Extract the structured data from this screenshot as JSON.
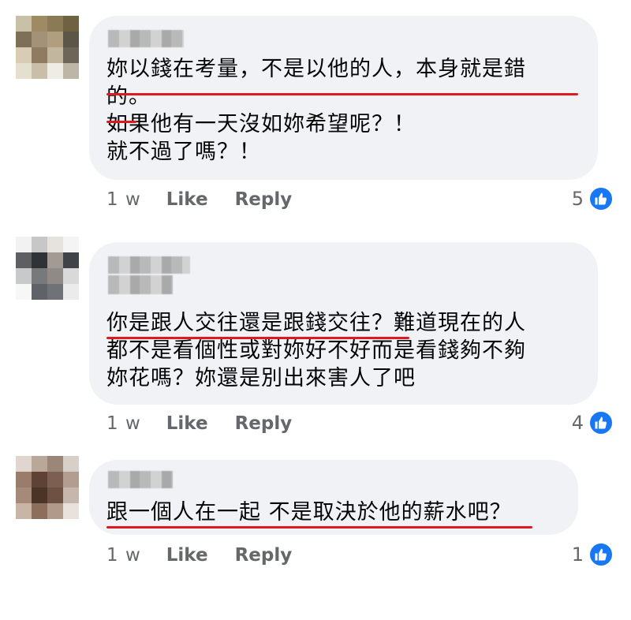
{
  "comments": [
    {
      "text": "妳以錢在考量，不是以他的人，本身就是錯\n的。\n如果他有一天沒如妳希望呢？！\n就不過了嗎？！",
      "time": "1 w",
      "like_label": "Like",
      "reply_label": "Reply",
      "reaction_count": "5",
      "reaction_icon": "thumbs-up-icon"
    },
    {
      "text": "你是跟人交往還是跟錢交往？難道現在的人\n都不是看個性或對妳好不好而是看錢夠不夠\n妳花嗎？妳還是別出來害人了吧",
      "time": "1 w",
      "like_label": "Like",
      "reply_label": "Reply",
      "reaction_count": "4",
      "reaction_icon": "thumbs-up-icon"
    },
    {
      "text": "跟一個人在一起 不是取決於他的薪水吧？",
      "time": "1 w",
      "like_label": "Like",
      "reply_label": "Reply",
      "reaction_count": "1",
      "reaction_icon": "thumbs-up-icon"
    }
  ],
  "colors": {
    "bubble": "#f0f2f5",
    "underline": "#e0191f",
    "like_blue": "#1877f2",
    "meta_gray": "#65676b"
  }
}
